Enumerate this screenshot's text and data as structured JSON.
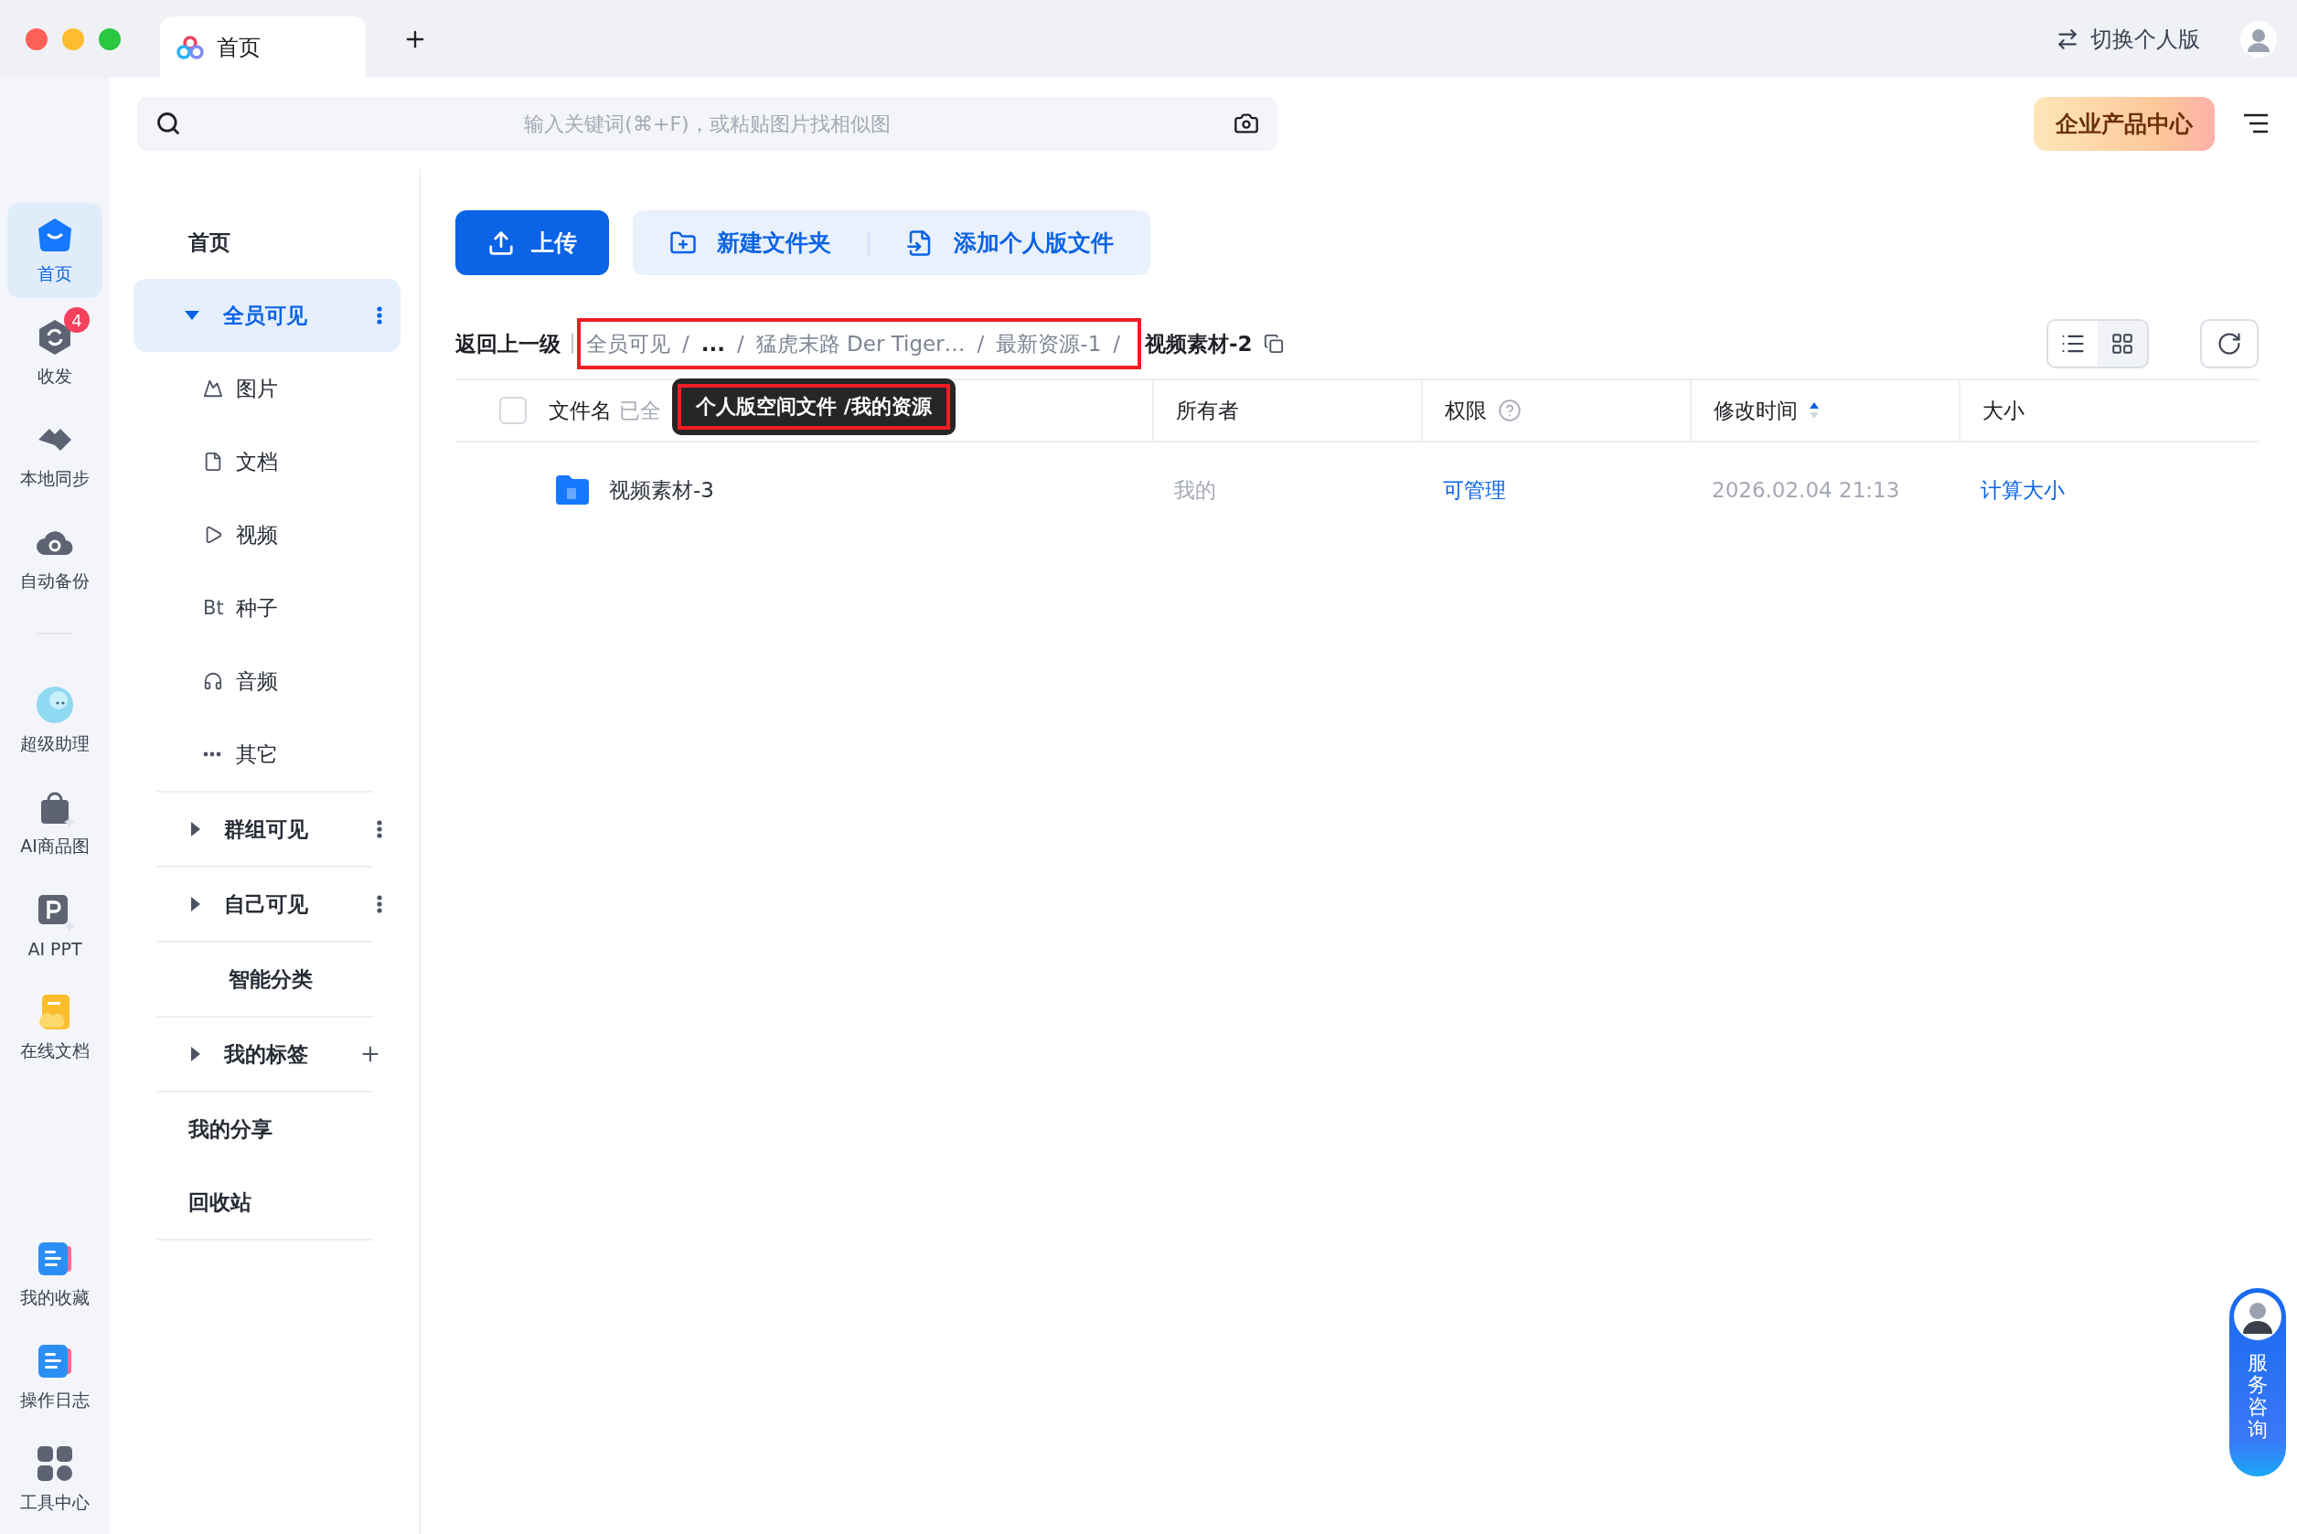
{
  "window": {
    "tabs": [
      {
        "label": "首页",
        "selected": true
      }
    ],
    "switch_button": "切换个人版"
  },
  "search": {
    "placeholder": "输入关键词(⌘+F)，或粘贴图片找相似图"
  },
  "enterprise_button": "企业产品中心",
  "rail": {
    "top": [
      {
        "kind": "home",
        "label": "首页",
        "selected": true
      },
      {
        "kind": "transfer",
        "label": "收发",
        "selected": false,
        "badge": "4"
      },
      {
        "kind": "sync",
        "label": "本地同步",
        "selected": false
      },
      {
        "kind": "backup",
        "label": "自动备份",
        "selected": false
      }
    ],
    "apps": [
      {
        "kind": "assistant",
        "label": "超级助理",
        "selected": false
      },
      {
        "kind": "aiimage",
        "label": "AI商品图",
        "selected": false
      },
      {
        "kind": "aippt",
        "label": "AI PPT",
        "selected": false
      },
      {
        "kind": "docs",
        "label": "在线文档",
        "selected": false
      }
    ],
    "bottom": [
      {
        "kind": "favorites",
        "label": "我的收藏",
        "selected": false
      },
      {
        "kind": "log",
        "label": "操作日志",
        "selected": false
      },
      {
        "kind": "tools",
        "label": "工具中心",
        "selected": false
      }
    ]
  },
  "sidebar": [
    {
      "kind": "link",
      "label": "首页",
      "selected": false
    },
    {
      "kind": "section",
      "label": "全员可见",
      "selected": true,
      "expanded": true,
      "children": [
        {
          "kind": "image",
          "label": "图片"
        },
        {
          "kind": "doc",
          "label": "文档"
        },
        {
          "kind": "video",
          "label": "视频"
        },
        {
          "kind": "text",
          "glyph": "Bt",
          "label": "种子"
        },
        {
          "kind": "audio",
          "label": "音频"
        },
        {
          "kind": "other",
          "label": "其它"
        }
      ]
    },
    {
      "kind": "section",
      "label": "群组可见",
      "selected": false,
      "expanded": false
    },
    {
      "kind": "section",
      "label": "自己可见",
      "selected": false,
      "expanded": false
    },
    {
      "kind": "category",
      "label": "智能分类",
      "selected": false
    },
    {
      "kind": "tags",
      "label": "我的标签",
      "selected": false,
      "expanded": false
    },
    {
      "kind": "link",
      "label": "我的分享",
      "selected": false
    },
    {
      "kind": "link",
      "label": "回收站",
      "selected": false
    }
  ],
  "toolbar": {
    "upload": "上传",
    "new_folder": "新建文件夹",
    "add_personal": "添加个人版文件"
  },
  "breadcrumb": {
    "back": "返回上一级",
    "separator": "/",
    "path": [
      "全员可见",
      "...",
      "猛虎末路 Der Tiger…",
      "最新资源-1"
    ],
    "current": "视频素材-2",
    "highlighted": true
  },
  "tooltip": {
    "text": "个人版空间文件 /我的资源",
    "highlighted": true
  },
  "view": [
    {
      "kind": "list",
      "selected": true
    },
    {
      "kind": "grid",
      "selected": false
    }
  ],
  "table": {
    "all_checked": false,
    "columns": [
      {
        "kind": "name",
        "label": "文件名",
        "hint": "已全"
      },
      {
        "kind": "plain",
        "label": "所有者"
      },
      {
        "kind": "help",
        "label": "权限"
      },
      {
        "kind": "sort",
        "label": "修改时间",
        "sort_ascending": true
      },
      {
        "kind": "plain",
        "label": "大小"
      }
    ],
    "rows": [
      {
        "name": "视频素材-3",
        "owner": "我的",
        "permission": "可管理",
        "modified": "2026.02.04 21:13",
        "size": "计算大小"
      }
    ]
  },
  "service_button": "服务咨询"
}
